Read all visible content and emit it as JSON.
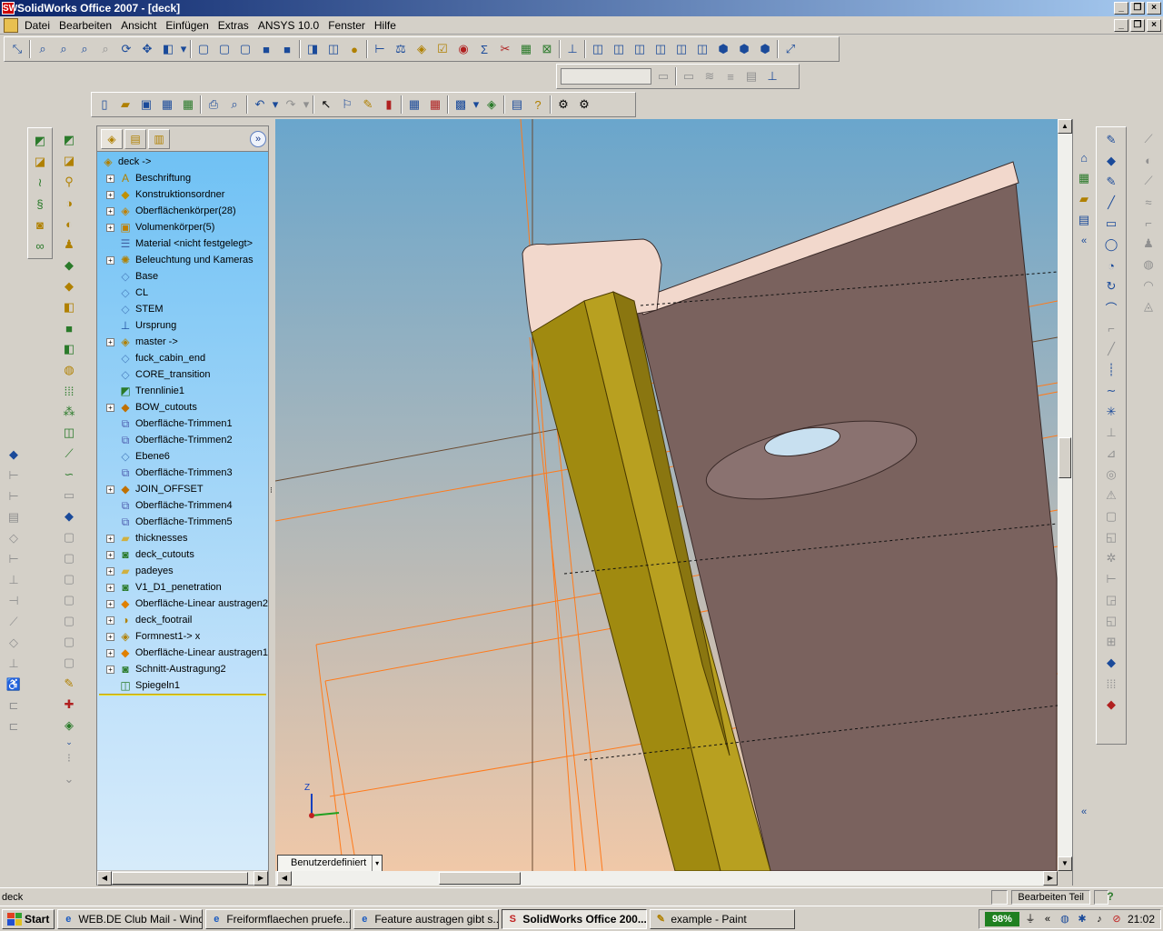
{
  "window": {
    "title": "SolidWorks Office 2007 - [deck]",
    "app_icon": "SW"
  },
  "menu": {
    "items": [
      "Datei",
      "Bearbeiten",
      "Ansicht",
      "Einfügen",
      "Extras",
      "ANSYS 10.0",
      "Fenster",
      "Hilfe"
    ]
  },
  "feature_tree": {
    "root": "deck ->",
    "items": [
      {
        "label": "Beschriftung",
        "icon": "annotation-icon",
        "expandable": true
      },
      {
        "label": "Konstruktionsordner",
        "icon": "design-binder-icon",
        "expandable": true
      },
      {
        "label": "Oberflächenkörper(28)",
        "icon": "surface-bodies-icon",
        "expandable": true
      },
      {
        "label": "Volumenkörper(5)",
        "icon": "solid-bodies-icon",
        "expandable": true
      },
      {
        "label": "Material <nicht festgelegt>",
        "icon": "material-icon",
        "expandable": false
      },
      {
        "label": "Beleuchtung und Kameras",
        "icon": "lights-icon",
        "expandable": true
      },
      {
        "label": "Base",
        "icon": "plane-icon",
        "expandable": false
      },
      {
        "label": "CL",
        "icon": "plane-icon",
        "expandable": false
      },
      {
        "label": "STEM",
        "icon": "plane-icon",
        "expandable": false
      },
      {
        "label": "Ursprung",
        "icon": "origin-icon",
        "expandable": false
      },
      {
        "label": "master ->",
        "icon": "part-icon",
        "expandable": true
      },
      {
        "label": "fuck_cabin_end",
        "icon": "plane-icon",
        "expandable": false
      },
      {
        "label": "CORE_transition",
        "icon": "plane-icon",
        "expandable": false
      },
      {
        "label": "Trennlinie1",
        "icon": "split-line-icon",
        "expandable": false
      },
      {
        "label": "BOW_cutouts",
        "icon": "surface-feature-icon",
        "expandable": true
      },
      {
        "label": "Oberfläche-Trimmen1",
        "icon": "surface-trim-icon",
        "expandable": false
      },
      {
        "label": "Oberfläche-Trimmen2",
        "icon": "surface-trim-icon",
        "expandable": false
      },
      {
        "label": "Ebene6",
        "icon": "plane-icon",
        "expandable": false
      },
      {
        "label": "Oberfläche-Trimmen3",
        "icon": "surface-trim-icon",
        "expandable": false
      },
      {
        "label": "JOIN_OFFSET",
        "icon": "surface-feature-icon",
        "expandable": true
      },
      {
        "label": "Oberfläche-Trimmen4",
        "icon": "surface-trim-icon",
        "expandable": false
      },
      {
        "label": "Oberfläche-Trimmen5",
        "icon": "surface-trim-icon",
        "expandable": false
      },
      {
        "label": "thicknesses",
        "icon": "folder-icon",
        "expandable": true
      },
      {
        "label": "deck_cutouts",
        "icon": "cut-feature-icon",
        "expandable": true
      },
      {
        "label": "padeyes",
        "icon": "folder-icon",
        "expandable": true
      },
      {
        "label": "V1_D1_penetration",
        "icon": "cut-feature-icon",
        "expandable": true
      },
      {
        "label": "Oberfläche-Linear austragen2",
        "icon": "surface-extrude-icon",
        "expandable": true
      },
      {
        "label": "deck_footrail",
        "icon": "sweep-icon",
        "expandable": true
      },
      {
        "label": "Formnest1-> x",
        "icon": "cavity-icon",
        "expandable": true
      },
      {
        "label": "Oberfläche-Linear austragen1",
        "icon": "surface-extrude-icon",
        "expandable": true
      },
      {
        "label": "Schnitt-Austragung2",
        "icon": "cut-extrude-icon",
        "expandable": true
      },
      {
        "label": "Spiegeln1",
        "icon": "mirror-icon",
        "expandable": false
      }
    ]
  },
  "viewport": {
    "view_orientation": "Benutzerdefiniert",
    "triad_label": "Z",
    "colors": {
      "sky_top": "#6aa6cc",
      "sky_bottom": "#f0c8a8",
      "hull": "#7a625e",
      "deck_top": "#f2d8cc",
      "yellow_face": "#a08a10",
      "sketch_line": "#ff7a1a"
    }
  },
  "status": {
    "left": "deck",
    "mode": "Bearbeiten Teil"
  },
  "taskbar": {
    "start_label": "Start",
    "buttons": [
      {
        "label": "WEB.DE Club Mail - Wind...",
        "icon": "ie-icon",
        "active": false
      },
      {
        "label": "Freiformflaechen pruefe...",
        "icon": "ie-icon",
        "active": false
      },
      {
        "label": "Feature austragen gibt s...",
        "icon": "ie-icon",
        "active": false
      },
      {
        "label": "SolidWorks Office 200...",
        "icon": "solidworks-icon",
        "active": true
      },
      {
        "label": "example - Paint",
        "icon": "paint-icon",
        "active": false
      }
    ],
    "battery": "98%",
    "clock": "21:02"
  }
}
